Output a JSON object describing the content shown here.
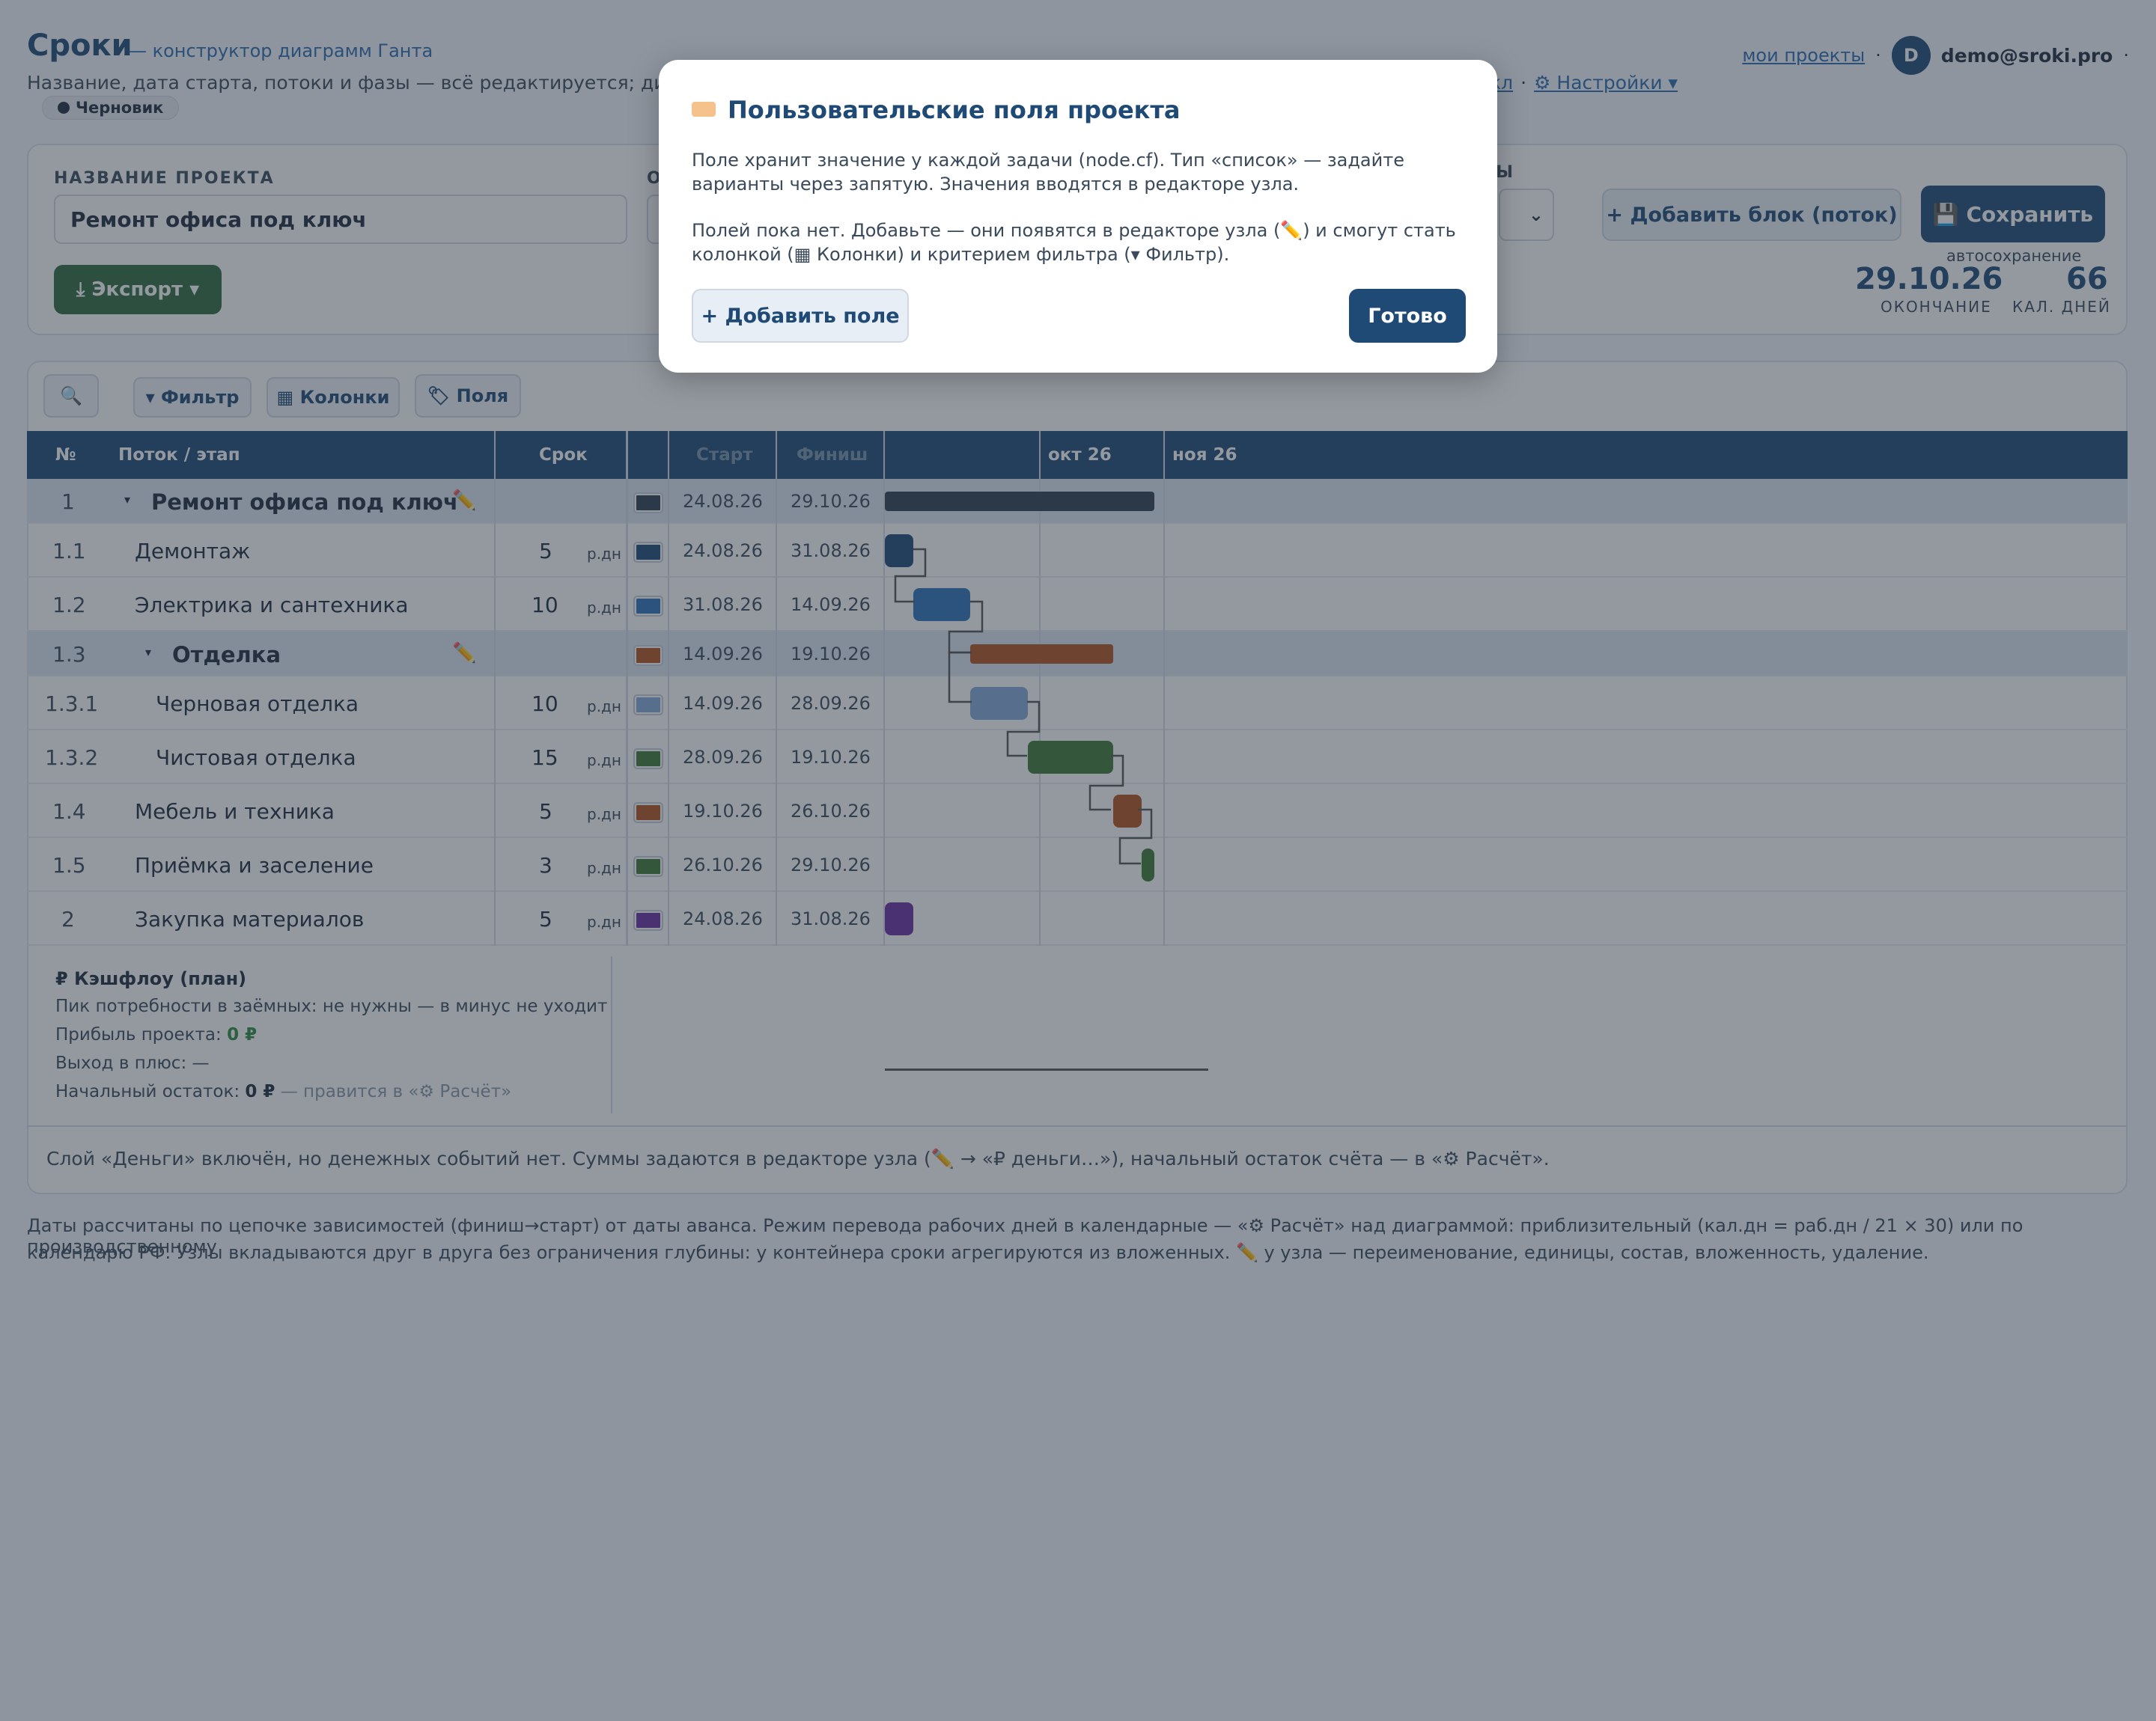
{
  "header": {
    "brand": "Сроки",
    "subtitle": "— конструктор диаграмм Ганта",
    "description": "Название, дата старта, потоки и фазы — всё редактируется; диагр",
    "desc_tail_link": "кл",
    "settings_link": "⚙ Настройки ▾",
    "my_projects": "мои проекты",
    "separator": "·",
    "avatar_letter": "D",
    "user_email": "demo@sroki.pro",
    "status_badge": "Черновик"
  },
  "project": {
    "name_label": "НАЗВАНИЕ ПРОЕКТА",
    "name_value": "Ремонт офиса под ключ",
    "second_label_fragment": "О",
    "third_label_fragment": "ЛЫ",
    "export_label": "⤓ Экспорт ▾",
    "add_block_label": "+ Добавить блок (поток)",
    "save_label": "💾 Сохранить",
    "autosave": "автосохранение",
    "end_date": "29.10.26",
    "end_label": "ОКОНЧАНИЕ",
    "cal_days": "66",
    "cal_days_label": "КАЛ. ДНЕЙ"
  },
  "toolbar": {
    "search_icon": "🔍",
    "filter_label": "▾ Фильтр",
    "columns_label": "▦ Колонки",
    "fields_label": "🏷 Поля"
  },
  "table": {
    "headers": {
      "num": "№",
      "name": "Поток / этап",
      "duration": "Срок",
      "start": "Старт",
      "finish": "Финиш",
      "month1": "окт 26",
      "month2": "ноя 26"
    },
    "unit": "р.дн",
    "rows": [
      {
        "num": "1",
        "name": "Ремонт офиса под ключ",
        "dur": "",
        "start": "24.08.26",
        "finish": "29.10.26",
        "color": "#2d3f4f",
        "group": true
      },
      {
        "num": "1.1",
        "name": "Демонтаж",
        "dur": "5",
        "start": "24.08.26",
        "finish": "31.08.26",
        "color": "#1e4a75",
        "group": false
      },
      {
        "num": "1.2",
        "name": "Электрика и сантехника",
        "dur": "10",
        "start": "31.08.26",
        "finish": "14.09.26",
        "color": "#2f73b8",
        "group": false
      },
      {
        "num": "1.3",
        "name": "Отделка",
        "dur": "",
        "start": "14.09.26",
        "finish": "19.10.26",
        "color": "#b3531c",
        "group": true
      },
      {
        "num": "1.3.1",
        "name": "Черновая отделка",
        "dur": "10",
        "start": "14.09.26",
        "finish": "28.09.26",
        "color": "#84a9d6",
        "group": false
      },
      {
        "num": "1.3.2",
        "name": "Чистовая отделка",
        "dur": "15",
        "start": "28.09.26",
        "finish": "19.10.26",
        "color": "#3f7a34",
        "group": false
      },
      {
        "num": "1.4",
        "name": "Мебель и техника",
        "dur": "5",
        "start": "19.10.26",
        "finish": "26.10.26",
        "color": "#b3531c",
        "group": false
      },
      {
        "num": "1.5",
        "name": "Приёмка и заселение",
        "dur": "3",
        "start": "26.10.26",
        "finish": "29.10.26",
        "color": "#3f7a34",
        "group": false
      },
      {
        "num": "2",
        "name": "Закупка материалов",
        "dur": "5",
        "start": "24.08.26",
        "finish": "31.08.26",
        "color": "#6a2fa0",
        "group": false
      }
    ]
  },
  "cashflow": {
    "title": "₽ Кэшфлоу (план)",
    "peak": "Пик потребности в заёмных: не нужны — в минус не уходит",
    "profit_label": "Прибыль проекта:",
    "profit_value": "0 ₽",
    "breakeven": "Выход в плюс: —",
    "opening_label": "Начальный остаток:",
    "opening_value": "0 ₽",
    "opening_note": "— правится в «⚙ Расчёт»",
    "money_note": "Слой «Деньги» включён, но денежных событий нет. Суммы задаются в редакторе узла (✏️ → «₽ деньги…»), начальный остаток счёта — в «⚙ Расчёт»."
  },
  "footer": {
    "line1": "Даты рассчитаны по цепочке зависимостей (финиш→старт) от даты аванса. Режим перевода рабочих дней в календарные — «⚙ Расчёт» над диаграммой: приблизительный (кал.дн = раб.дн / 21 × 30) или по производственному",
    "line2": "календарю РФ. Узлы вкладываются друг в друга без ограничения глубины: у контейнера сроки агрегируются из вложенных. ✏️ у узла — переименование, единицы, состав, вложенность, удаление."
  },
  "modal": {
    "title": "Пользовательские поля проекта",
    "text1": "Поле хранит значение у каждой задачи (node.cf). Тип «список» — задайте варианты через запятую. Значения вводятся в редакторе узла.",
    "text2": "Полей пока нет. Добавьте — они появятся в редакторе узла (✏️) и смогут стать колонкой (▦ Колонки) и критерием фильтра (▾ Фильтр).",
    "add_field": "+ Добавить поле",
    "done": "Готово"
  },
  "colors": {
    "brand": "#1e4a75",
    "export": "#2e6b3f",
    "accent_link": "#2a6db0",
    "profit": "#2e8b3e"
  },
  "gantt": {
    "timeline_start": "24.08.26",
    "bars": [
      {
        "start": "24.08.26",
        "end": "29.10.26",
        "color": "#2d3f4f"
      },
      {
        "start": "24.08.26",
        "end": "31.08.26",
        "color": "#1e4a75"
      },
      {
        "start": "31.08.26",
        "end": "14.09.26",
        "color": "#2f73b8"
      },
      {
        "start": "14.09.26",
        "end": "19.10.26",
        "color": "#b3531c"
      },
      {
        "start": "14.09.26",
        "end": "28.09.26",
        "color": "#84a9d6"
      },
      {
        "start": "28.09.26",
        "end": "19.10.26",
        "color": "#3f7a34"
      },
      {
        "start": "19.10.26",
        "end": "26.10.26",
        "color": "#b3531c"
      },
      {
        "start": "26.10.26",
        "end": "29.10.26",
        "color": "#3f7a34"
      },
      {
        "start": "24.08.26",
        "end": "31.08.26",
        "color": "#6a2fa0"
      }
    ]
  }
}
